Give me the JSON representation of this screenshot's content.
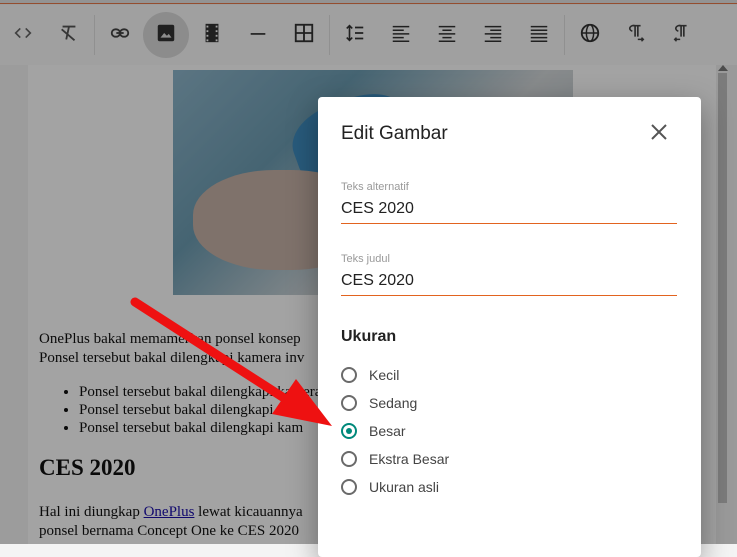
{
  "toolbar": {
    "buttons": [
      {
        "name": "source-code",
        "icon": "code-icon"
      },
      {
        "name": "clear-format",
        "icon": "clear-format-icon"
      },
      {
        "name": "link",
        "icon": "link-icon"
      },
      {
        "name": "image",
        "icon": "image-icon",
        "active": true
      },
      {
        "name": "video",
        "icon": "film-icon"
      },
      {
        "name": "horizontal-line",
        "icon": "horizontal-rule-icon"
      },
      {
        "name": "table",
        "icon": "table-icon"
      },
      {
        "name": "line-height",
        "icon": "line-height-icon"
      },
      {
        "name": "align-left",
        "icon": "align-left-icon"
      },
      {
        "name": "align-center",
        "icon": "align-center-icon"
      },
      {
        "name": "align-right",
        "icon": "align-right-icon"
      },
      {
        "name": "align-justify",
        "icon": "align-justify-icon"
      },
      {
        "name": "language",
        "icon": "globe-icon"
      },
      {
        "name": "ltr",
        "icon": "paragraph-ltr-icon"
      },
      {
        "name": "rtl",
        "icon": "paragraph-rtl-icon"
      }
    ]
  },
  "editor": {
    "para1_line1": "OnePlus bakal memamerkan ponsel konsep",
    "para1_line2": "Ponsel tersebut bakal dilengkapi kamera inv",
    "list": [
      "Ponsel tersebut bakal dilengkapi kamera",
      "Ponsel tersebut bakal dilengkapi",
      "Ponsel tersebut bakal dilengkapi kam"
    ],
    "heading": "CES 2020",
    "para2_prefix": "Hal ini diungkap ",
    "para2_link": "OnePlus",
    "para2_suffix": " lewat kicauannya",
    "para2_line2": "ponsel bernama Concept One ke CES 2020"
  },
  "dialog": {
    "title": "Edit Gambar",
    "alt_label": "Teks alternatif",
    "alt_value": "CES 2020",
    "title_label": "Teks judul",
    "title_value": "CES 2020",
    "size_section": "Ukuran",
    "sizes": [
      {
        "label": "Kecil",
        "checked": false
      },
      {
        "label": "Sedang",
        "checked": false
      },
      {
        "label": "Besar",
        "checked": true
      },
      {
        "label": "Ekstra Besar",
        "checked": false
      },
      {
        "label": "Ukuran asli",
        "checked": false
      }
    ]
  },
  "colors": {
    "accent_radio": "#00897b",
    "input_underline": "#e2631f",
    "arrow": "#ee1111"
  }
}
